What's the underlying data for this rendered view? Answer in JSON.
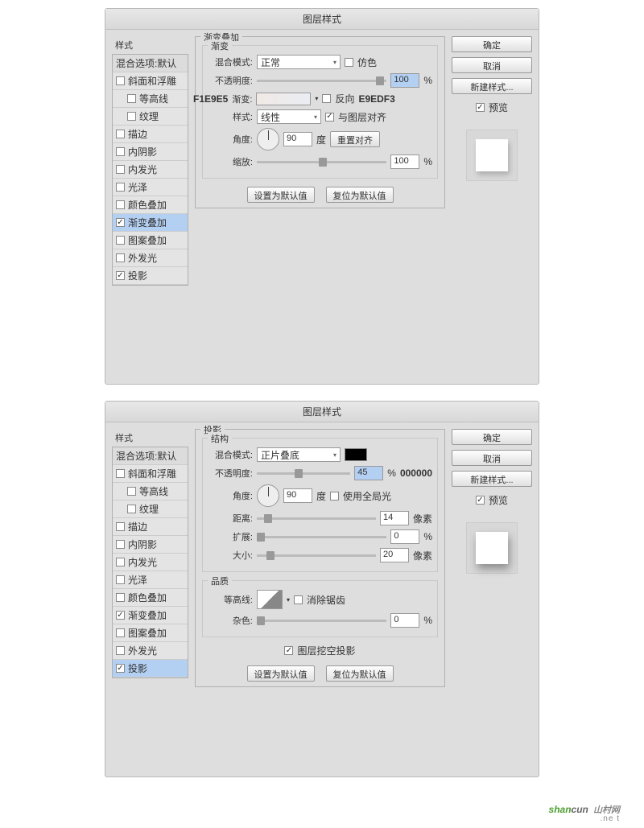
{
  "dialogTitle": "图层样式",
  "sidebar": {
    "header": "样式",
    "blendHeader": "混合选项:默认",
    "items": [
      {
        "label": "斜面和浮雕",
        "checked": false,
        "indent": false
      },
      {
        "label": "等高线",
        "checked": false,
        "indent": true
      },
      {
        "label": "纹理",
        "checked": false,
        "indent": true
      },
      {
        "label": "描边",
        "checked": false,
        "indent": false
      },
      {
        "label": "内阴影",
        "checked": false,
        "indent": false
      },
      {
        "label": "内发光",
        "checked": false,
        "indent": false
      },
      {
        "label": "光泽",
        "checked": false,
        "indent": false
      },
      {
        "label": "颜色叠加",
        "checked": false,
        "indent": false
      },
      {
        "label": "渐变叠加",
        "checked": true,
        "indent": false,
        "sel1": true
      },
      {
        "label": "图案叠加",
        "checked": false,
        "indent": false
      },
      {
        "label": "外发光",
        "checked": false,
        "indent": false
      },
      {
        "label": "投影",
        "checked": true,
        "indent": false,
        "sel2": true
      }
    ]
  },
  "buttons": {
    "ok": "确定",
    "cancel": "取消",
    "newStyle": "新建样式...",
    "preview": "预览"
  },
  "defaults": {
    "set": "设置为默认值",
    "reset": "复位为默认值"
  },
  "panel1": {
    "title": "渐变叠加",
    "subtitle": "渐变",
    "blendMode": "混合模式:",
    "blendValue": "正常",
    "dither": "仿色",
    "opacity": "不透明度:",
    "opacityVal": "100",
    "pct": "%",
    "gradient": "渐变:",
    "reverse": "反向",
    "annoLeft": "F1E9E5",
    "annoRight": "E9EDF3",
    "style": "样式:",
    "styleVal": "线性",
    "align": "与图层对齐",
    "angle": "角度:",
    "angleVal": "90",
    "degree": "度",
    "resetAlign": "重置对齐",
    "scale": "缩放:",
    "scaleVal": "100"
  },
  "panel2": {
    "title": "投影",
    "subtitle": "结构",
    "blendMode": "混合模式:",
    "blendValue": "正片叠底",
    "opacity": "不透明度:",
    "opacityVal": "45",
    "pct": "%",
    "annoColor": "000000",
    "angle": "角度:",
    "angleVal": "90",
    "degree": "度",
    "global": "使用全局光",
    "distance": "距离:",
    "distanceVal": "14",
    "px": "像素",
    "spread": "扩展:",
    "spreadVal": "0",
    "size": "大小:",
    "sizeVal": "20",
    "quality": "品质",
    "contour": "等高线:",
    "antialias": "消除锯齿",
    "noise": "杂色:",
    "noiseVal": "0",
    "knockout": "图层挖空投影"
  },
  "logo": {
    "text1": "shan",
    "text2": "cun",
    "sub": ".ne t",
    "alt": "山村网"
  }
}
